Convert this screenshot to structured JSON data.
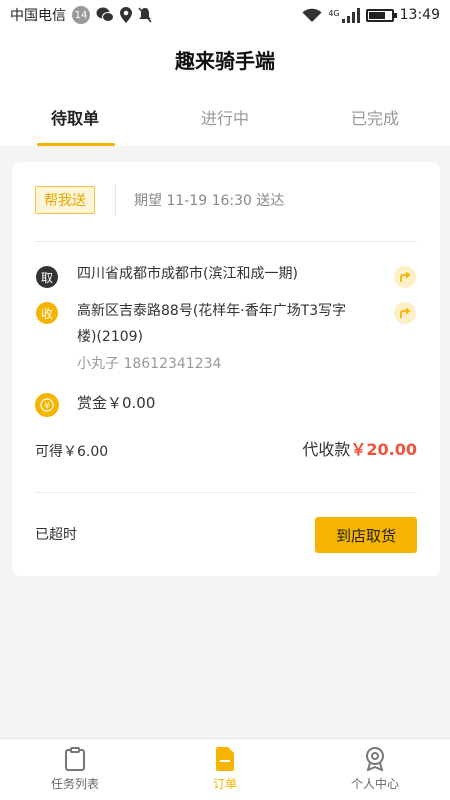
{
  "status": {
    "carrier": "中国电信",
    "badge": "14",
    "network": "4G",
    "time": "13:49"
  },
  "header": {
    "title": "趣来骑手端"
  },
  "tabs": [
    {
      "label": "待取单"
    },
    {
      "label": "进行中"
    },
    {
      "label": "已完成"
    }
  ],
  "order": {
    "tag": "帮我送",
    "expect": "期望 11-19 16:30 送达",
    "pick_icon": "取",
    "pick_address": "四川省成都市成都市(滨江和成一期)",
    "recv_icon": "收",
    "recv_address_line1": "高新区吉泰路88号(花样年·香年广场T3写字",
    "recv_address_line2": "楼)(2109)",
    "recv_contact": "小丸子 18612341234",
    "bounty": "赏金￥0.00",
    "earn": "可得￥6.00",
    "cod_label": "代收款",
    "cod_amount": "￥20.00",
    "status": "已超时",
    "action": "到店取货"
  },
  "nav": [
    {
      "label": "任务列表",
      "icon": "clipboard-icon"
    },
    {
      "label": "订单",
      "icon": "document-icon"
    },
    {
      "label": "个人中心",
      "icon": "profile-icon"
    }
  ],
  "colors": {
    "accent": "#f5b400",
    "price": "#f0523c",
    "background": "#f4f4f4"
  }
}
